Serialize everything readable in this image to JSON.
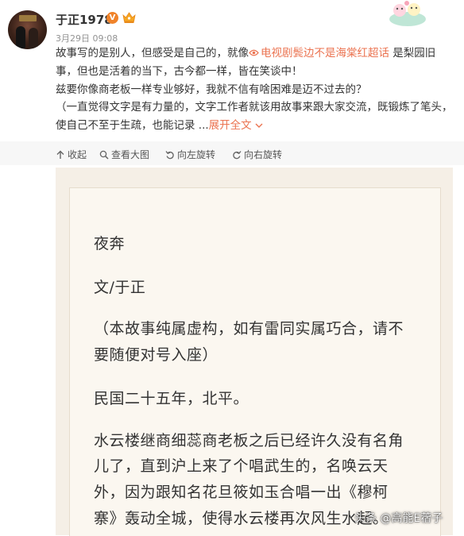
{
  "post": {
    "username": "于正1978",
    "verified_badge": "V",
    "timestamp": "3月29日 09:08",
    "line1_pre": "故事写的是别人，但感受是自己的，就像",
    "topic_link": "电视剧鬓边不是海棠红超话",
    "line1_post": " 是梨园旧事，但也是活着的当下，古今都一样，皆在笑谈中！",
    "line2": "兹要你像商老板一样专业够好，我就不信有啥困难是迈不过去的？",
    "line3": "（一直觉得文字是有力量的，文字工作者就该用故事来跟大家交流，既锻炼了笔头，使自己不至于生疏，也能记录 ...",
    "expand_label": "展开全文"
  },
  "toolbar": {
    "collapse": "收起",
    "view_large": "查看大图",
    "rotate_left": "向左旋转",
    "rotate_right": "向右旋转"
  },
  "document": {
    "title": "夜奔",
    "author": "文/于正",
    "disclaimer_1": "（本故事纯属虚构，如有雷同实属巧合，请不",
    "disclaimer_2": "要随便对号入座）",
    "setting": "民国二十五年，北平。",
    "para_1": "水云楼继商细蕊商老板之后已经许久没有名角",
    "para_2": "儿了，直到沪上来了个唱武生的，名唤云天",
    "para_3": "外，因为跟知名花旦筱如玉合唱一出《穆柯",
    "para_4": "寨》轰动全城，使得水云楼再次风生水起。"
  },
  "watermark": "头条 @高能E蓿子",
  "colors": {
    "accent_link": "#eb7350",
    "verified_orange": "#f0832a",
    "paper": "#f5efe6"
  },
  "icons": [
    "verified-icon",
    "crown-icon",
    "topic-icon",
    "chevron-down-icon",
    "collapse-icon",
    "view-large-icon",
    "rotate-left-icon",
    "rotate-right-icon"
  ]
}
